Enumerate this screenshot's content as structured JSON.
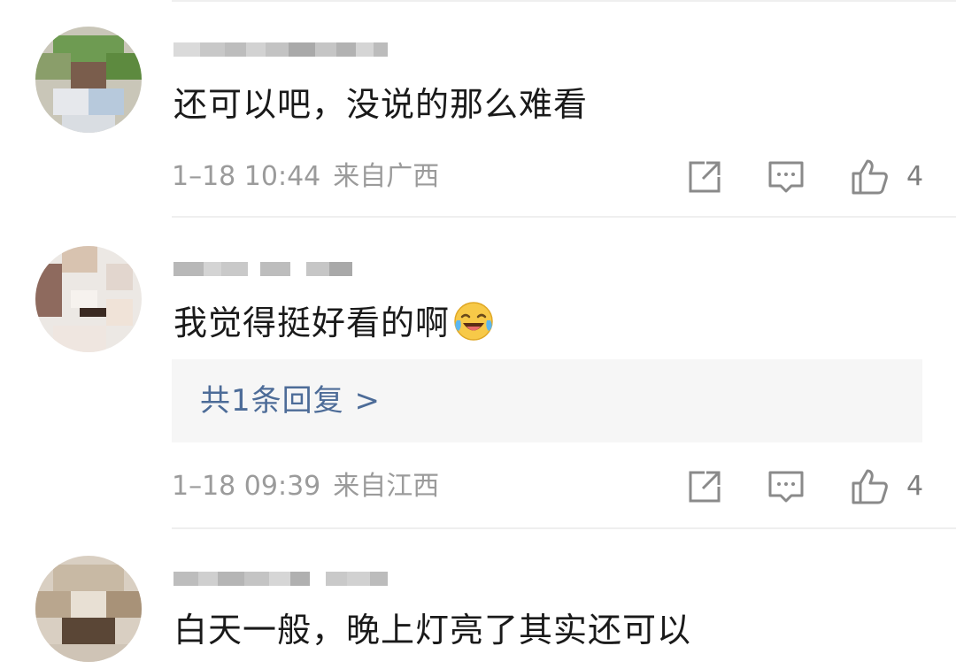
{
  "comments": [
    {
      "text": "还可以吧，没说的那么难看",
      "time": "1–18 10:44",
      "location": "来自广西",
      "likes": "4"
    },
    {
      "text": "我觉得挺好看的啊",
      "emoji": "laugh-cry-emoji",
      "reply_link": "共1条回复 >",
      "time": "1–18 09:39",
      "location": "来自江西",
      "likes": "4"
    },
    {
      "text": "白天一般，晚上灯亮了其实还可以"
    }
  ],
  "icons": {
    "share": "share-icon",
    "comment": "comment-icon",
    "like": "thumbs-up-icon"
  },
  "colors": {
    "meta": "#9b9b9b",
    "reply_link": "#4d6c98",
    "reply_bg": "#f6f6f6"
  }
}
